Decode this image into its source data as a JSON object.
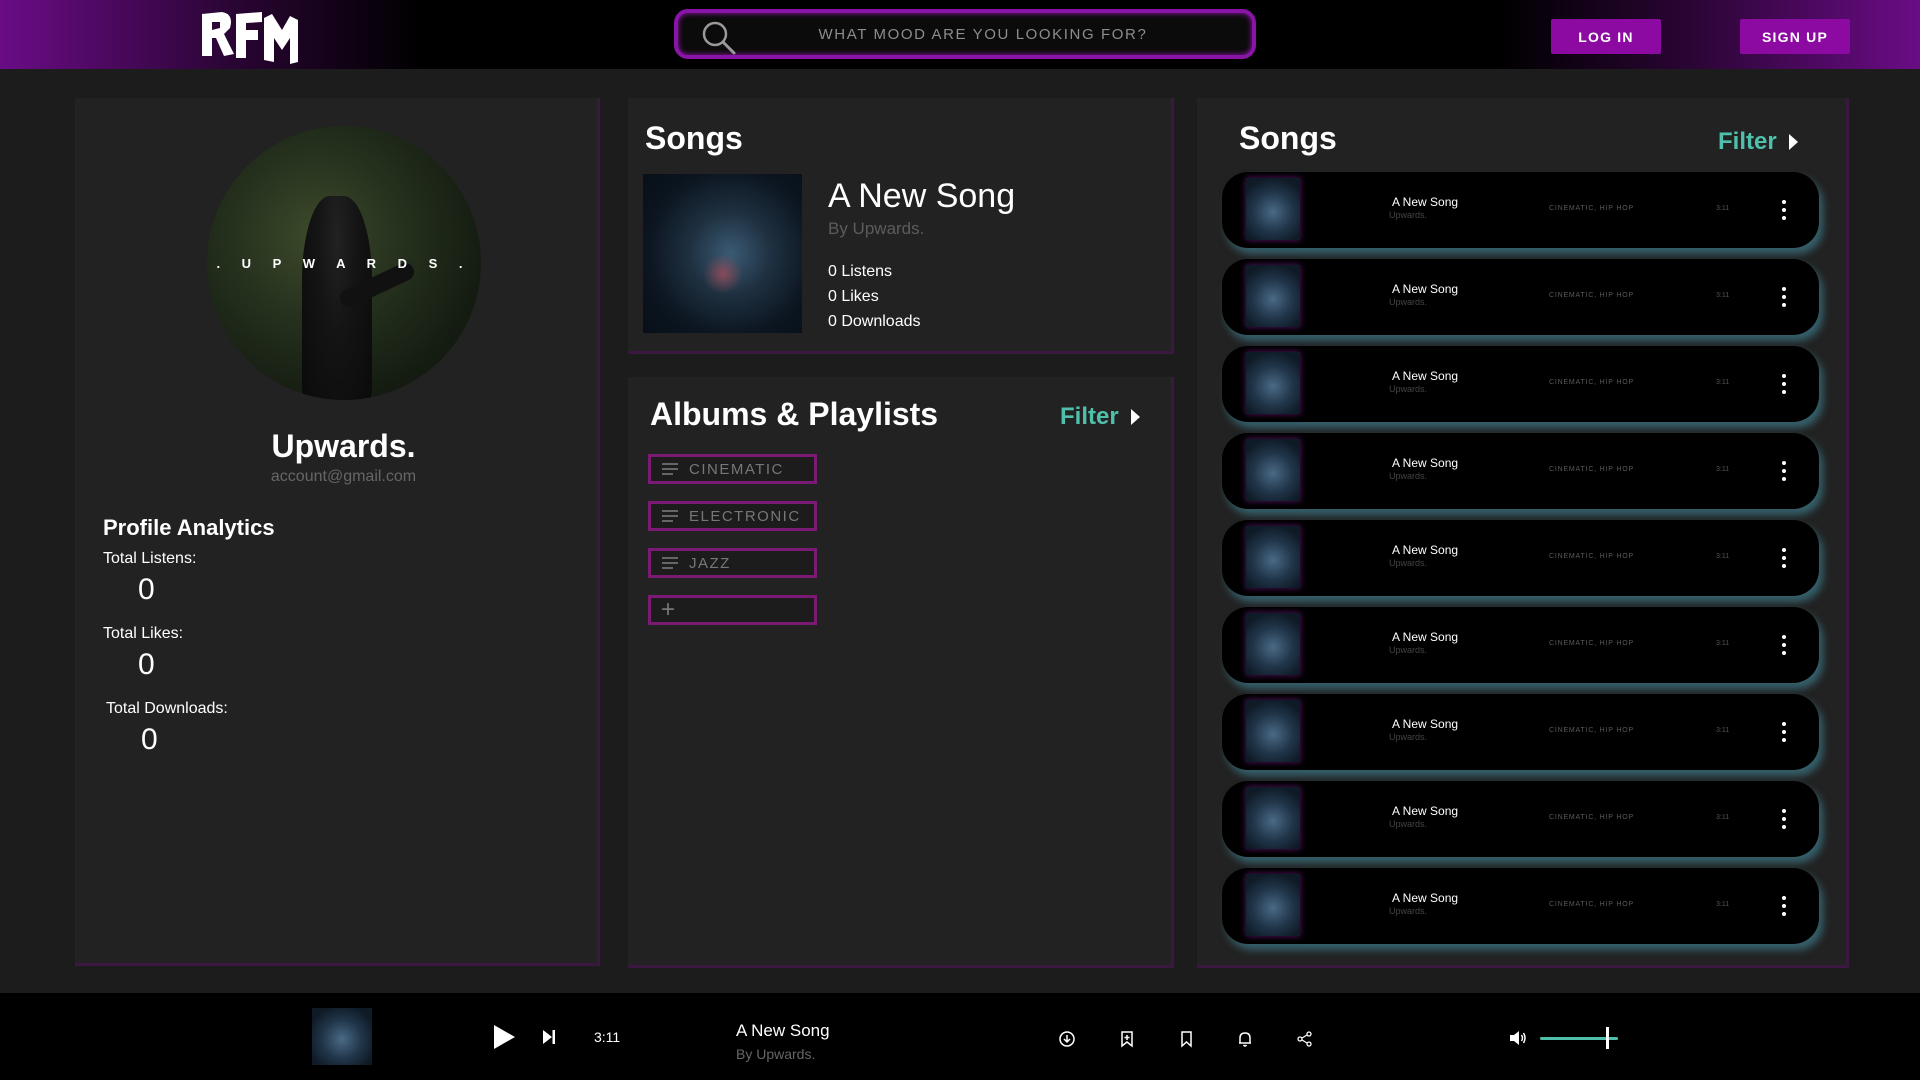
{
  "header": {
    "logo_text": "RFM",
    "search_placeholder": "WHAT MOOD ARE YOU LOOKING FOR?",
    "login_label": "LOG IN",
    "signup_label": "SIGN UP"
  },
  "profile": {
    "avatar_text": ". U P W A R D S .",
    "name": "Upwards.",
    "email": "account@gmail.com",
    "analytics_title": "Profile Analytics",
    "listens_label": "Total Listens:",
    "listens_value": "0",
    "likes_label": "Total Likes:",
    "likes_value": "0",
    "downloads_label": "Total Downloads:",
    "downloads_value": "0"
  },
  "featured": {
    "section_title": "Songs",
    "title": "A New Song",
    "by": "By Upwards.",
    "listens": "0 Listens",
    "likes": "0 Likes",
    "downloads": "0 Downloads"
  },
  "albums": {
    "section_title": "Albums & Playlists",
    "filter_label": "Filter",
    "items": [
      "CINEMATIC",
      "ELECTRONIC",
      "JAZZ"
    ],
    "add_symbol": "+"
  },
  "songs": {
    "section_title": "Songs",
    "filter_label": "Filter",
    "rows": [
      {
        "title": "A New Song",
        "artist": "Upwards.",
        "genre": "CINEMATIC, HIP HOP",
        "duration": "3:11"
      },
      {
        "title": "A New Song",
        "artist": "Upwards.",
        "genre": "CINEMATIC, HIP HOP",
        "duration": "3:11"
      },
      {
        "title": "A New Song",
        "artist": "Upwards.",
        "genre": "CINEMATIC, HIP HOP",
        "duration": "3:11"
      },
      {
        "title": "A New Song",
        "artist": "Upwards.",
        "genre": "CINEMATIC, HIP HOP",
        "duration": "3:11"
      },
      {
        "title": "A New Song",
        "artist": "Upwards.",
        "genre": "CINEMATIC, HIP HOP",
        "duration": "3:11"
      },
      {
        "title": "A New Song",
        "artist": "Upwards.",
        "genre": "CINEMATIC, HIP HOP",
        "duration": "3:11"
      },
      {
        "title": "A New Song",
        "artist": "Upwards.",
        "genre": "CINEMATIC, HIP HOP",
        "duration": "3:11"
      },
      {
        "title": "A New Song",
        "artist": "Upwards.",
        "genre": "CINEMATIC, HIP HOP",
        "duration": "3:11"
      },
      {
        "title": "A New Song",
        "artist": "Upwards.",
        "genre": "CINEMATIC, HIP HOP",
        "duration": "3:11"
      }
    ]
  },
  "player": {
    "time": "3:11",
    "title": "A New Song",
    "by": "By Upwards.",
    "volume_fraction": 0.85,
    "icons": [
      "download-icon",
      "bookmark-add-icon",
      "bookmark-icon",
      "bell-icon",
      "share-icon"
    ]
  },
  "colors": {
    "accent_purple": "#8c0aa2",
    "accent_teal": "#4ec0ac",
    "panel_bg": "#222222",
    "page_bg": "#1c1c1c"
  }
}
